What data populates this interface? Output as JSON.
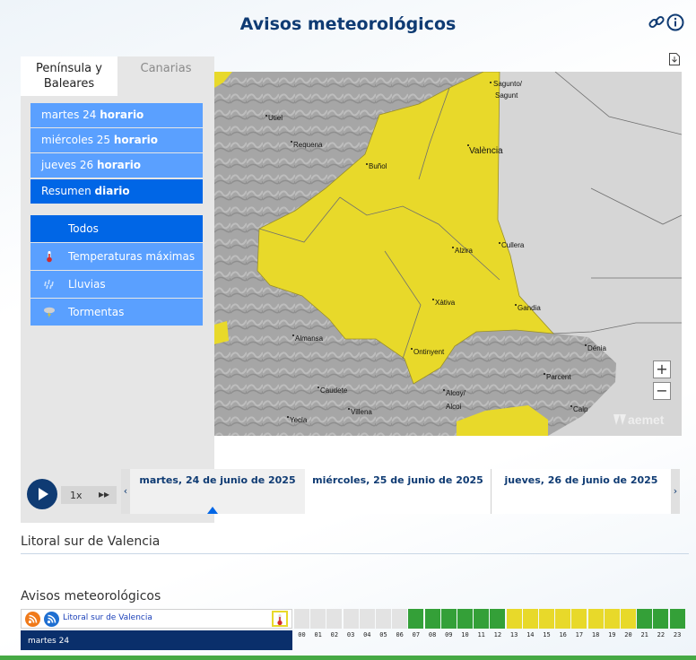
{
  "header": {
    "title": "Avisos meteorológicos"
  },
  "regions": {
    "peninsula": "Península y\nBaleares",
    "canarias": "Canarias"
  },
  "days": [
    {
      "prefix": "martes 24 ",
      "suffix": "horario"
    },
    {
      "prefix": "miércoles 25 ",
      "suffix": "horario"
    },
    {
      "prefix": "jueves 26 ",
      "suffix": "horario"
    },
    {
      "prefix": "Resumen ",
      "suffix": "diario"
    }
  ],
  "warning_types": [
    {
      "label": "Todos",
      "icon": "all-icon"
    },
    {
      "label": "Temperaturas máximas",
      "icon": "thermometer-icon"
    },
    {
      "label": "Lluvias",
      "icon": "rain-icon"
    },
    {
      "label": "Tormentas",
      "icon": "storm-icon"
    }
  ],
  "map": {
    "places": [
      "Sagunto/",
      "Sagunt",
      "Utiel",
      "Requena",
      "Buñol",
      "València",
      "Alzira",
      "Cullera",
      "Xàtiva",
      "Gandia",
      "Almansa",
      "Ontinyent",
      "Dénia",
      "Parcent",
      "Caudete",
      "Alcoy/",
      "Alcoi",
      "Villena",
      "Calp",
      "Yecla"
    ],
    "brand": "aemet",
    "zoom_in": "+",
    "zoom_out": "−"
  },
  "timeline": {
    "speed": "1x",
    "dates": [
      "martes, 24 de junio de 2025",
      "miércoles, 25 de junio de 2025",
      "jueves, 26 de junio de 2025"
    ]
  },
  "zone": {
    "title": "Litoral sur de Valencia"
  },
  "warnings": {
    "title": "Avisos meteorológicos",
    "row_label": "Litoral sur de Valencia",
    "day_label": "martes 24",
    "hours": [
      "00",
      "01",
      "02",
      "03",
      "04",
      "05",
      "06",
      "07",
      "08",
      "09",
      "10",
      "11",
      "12",
      "13",
      "14",
      "15",
      "16",
      "17",
      "18",
      "19",
      "20",
      "21",
      "22",
      "23"
    ],
    "levels": [
      "none",
      "none",
      "none",
      "none",
      "none",
      "none",
      "none",
      "green",
      "green",
      "green",
      "green",
      "green",
      "green",
      "yellow",
      "yellow",
      "yellow",
      "yellow",
      "yellow",
      "yellow",
      "yellow",
      "yellow",
      "green",
      "green",
      "green"
    ]
  },
  "colors": {
    "accent": "#0f3b73",
    "menu": "#5aa0ff",
    "menu_active": "#0066e6",
    "yellow": "#e8d92a",
    "green": "#34a038",
    "grey": "#e3e3e3"
  }
}
